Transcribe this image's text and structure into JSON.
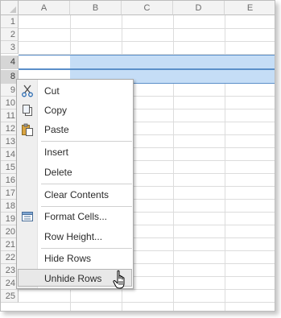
{
  "columns": [
    "A",
    "B",
    "C",
    "D",
    "E"
  ],
  "rows": [
    "1",
    "2",
    "3",
    "4",
    "8",
    "9",
    "10",
    "11",
    "12",
    "13",
    "14",
    "15",
    "16",
    "17",
    "18",
    "19",
    "20",
    "21",
    "22",
    "23",
    "24",
    "25"
  ],
  "selected_rows": [
    "4",
    "8"
  ],
  "colors": {
    "selection_fill": "#c5ddf6",
    "selection_border": "#5b8fc9"
  },
  "menu": {
    "items": [
      {
        "label": "Cut",
        "icon": "scissors-icon"
      },
      {
        "label": "Copy",
        "icon": "copy-icon"
      },
      {
        "label": "Paste",
        "icon": "paste-icon"
      },
      {
        "label": "Insert"
      },
      {
        "label": "Delete"
      },
      {
        "label": "Clear Contents"
      },
      {
        "label": "Format Cells...",
        "icon": "format-cells-icon"
      },
      {
        "label": "Row Height..."
      },
      {
        "label": "Hide Rows"
      },
      {
        "label": "Unhide Rows",
        "highlighted": true
      }
    ]
  }
}
